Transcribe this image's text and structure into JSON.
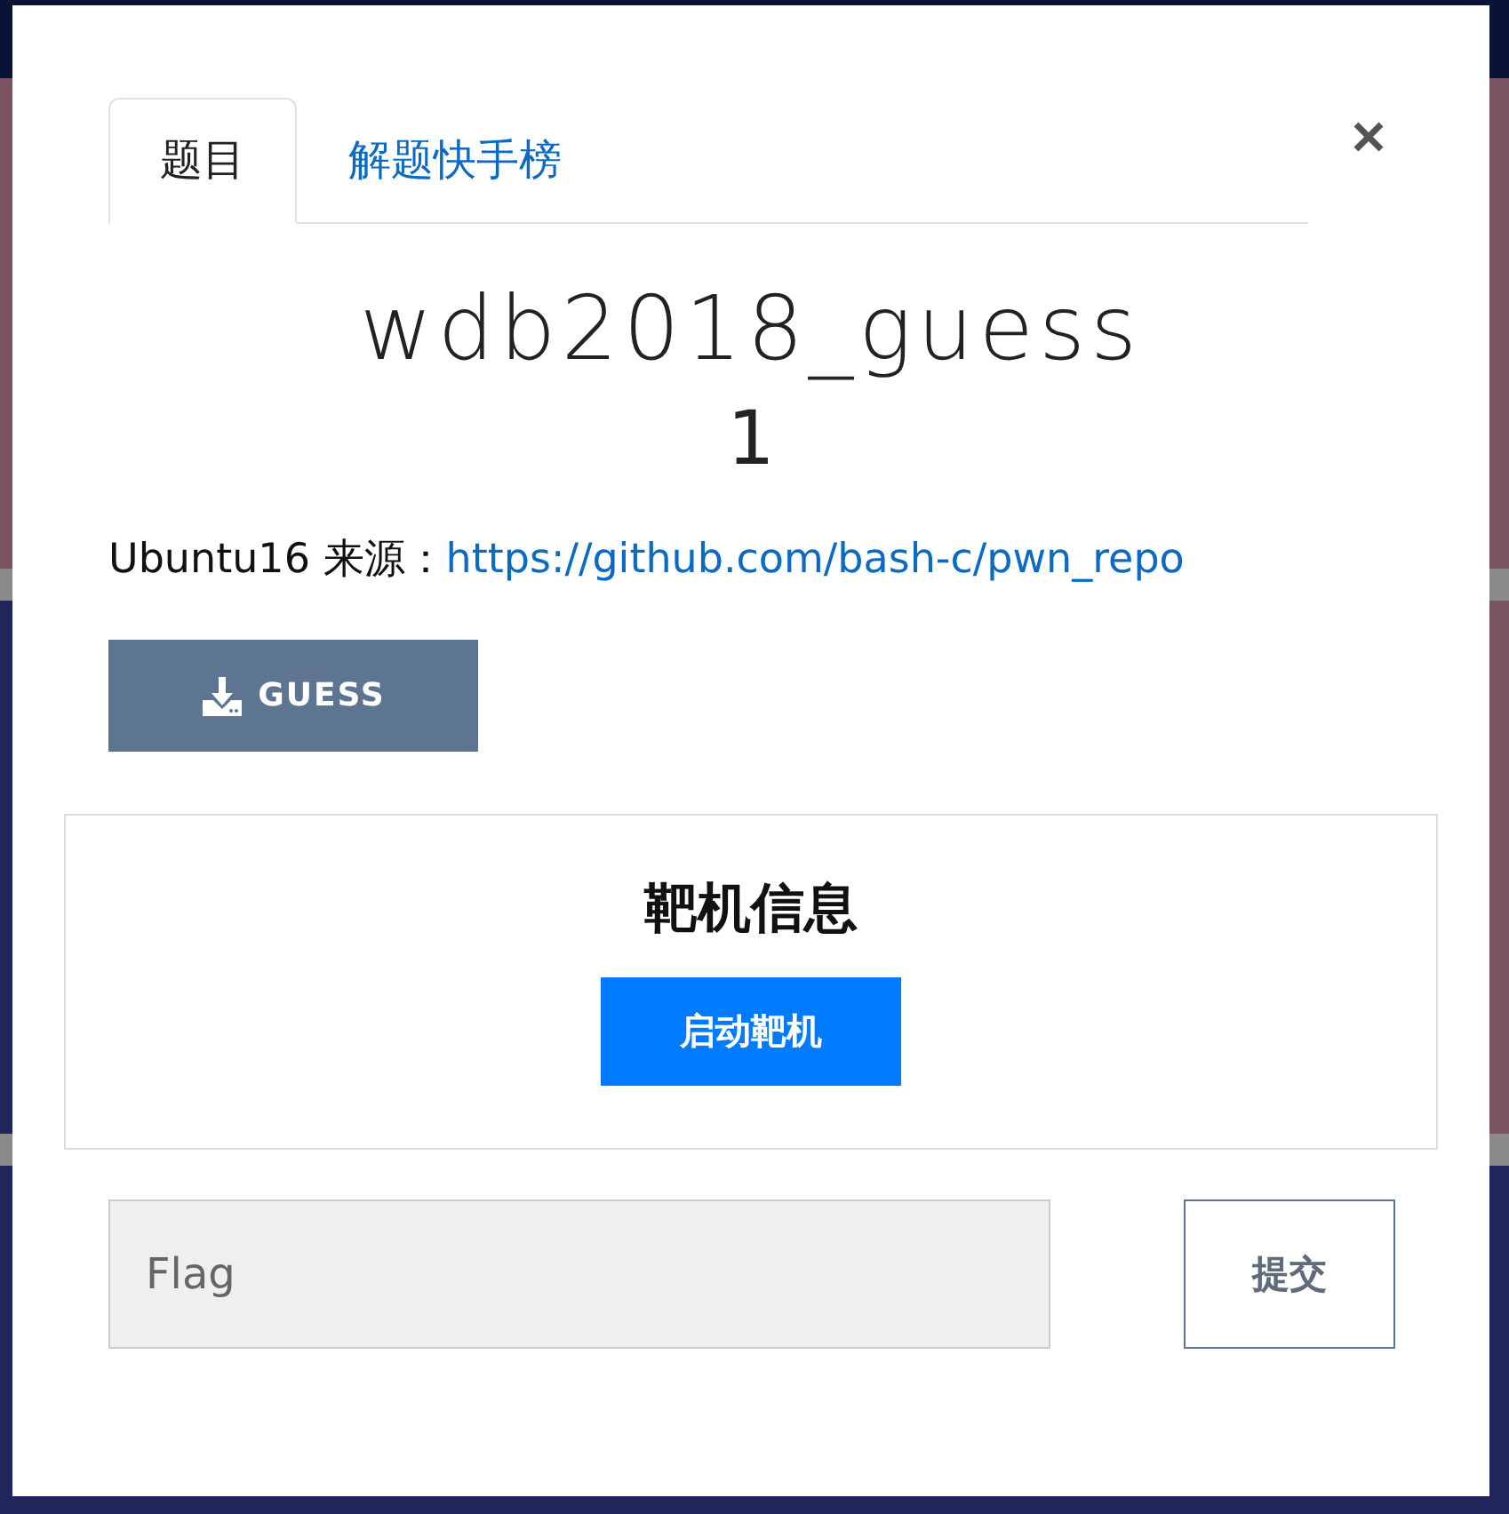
{
  "tabs": [
    {
      "label": "题目",
      "selected": true
    },
    {
      "label": "解题快手榜",
      "selected": false
    }
  ],
  "challenge": {
    "title": "wdb2018_guess",
    "points": "1",
    "description": "Ubuntu16 来源：",
    "link": "https://github.com/bash-c/pwn_repo",
    "download_button": "GUESS"
  },
  "target_panel": {
    "title": "靶机信息",
    "button": "启动靶机"
  },
  "flag_form": {
    "placeholder": "Flag",
    "submit": "提交"
  }
}
